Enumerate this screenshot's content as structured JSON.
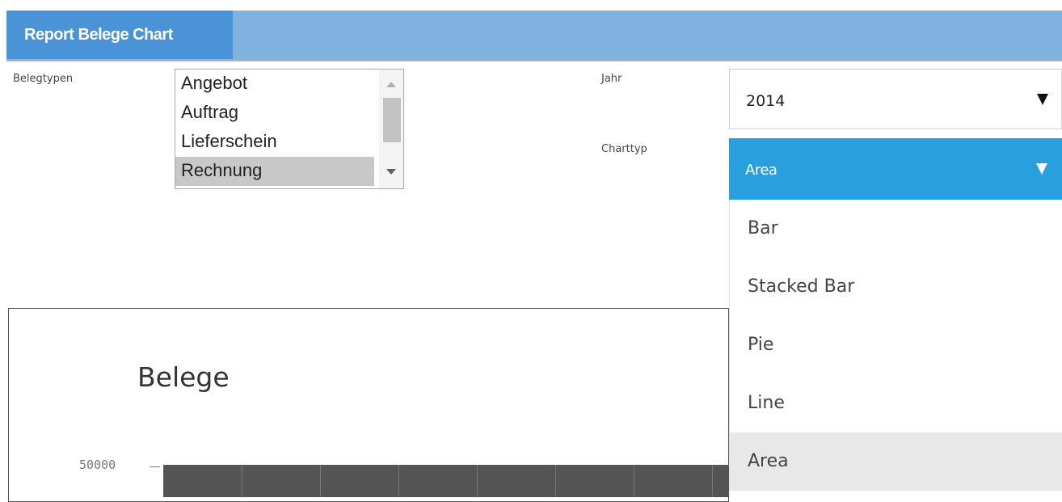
{
  "header": {
    "title": "Report Belege Chart"
  },
  "filters": {
    "belegtypen_label": "Belegtypen",
    "belegtypen_options": [
      {
        "label": "Angebot",
        "selected": false
      },
      {
        "label": "Auftrag",
        "selected": false
      },
      {
        "label": "Lieferschein",
        "selected": false
      },
      {
        "label": "Rechnung",
        "selected": true
      }
    ],
    "jahr_label": "Jahr",
    "jahr_value": "2014",
    "charttyp_label": "Charttyp",
    "charttyp_value": "Area",
    "charttyp_options": [
      "Bar",
      "Stacked Bar",
      "Pie",
      "Line",
      "Area"
    ]
  },
  "chart": {
    "title": "Belege",
    "y_ticks": [
      "50000"
    ]
  },
  "colors": {
    "header_bar": "#7fb2de",
    "header_tab": "#4a93d6",
    "select_accent": "#29a0dd",
    "plot_fill": "#545454"
  },
  "icons": {
    "dropdown_caret": "caret-down-icon"
  }
}
